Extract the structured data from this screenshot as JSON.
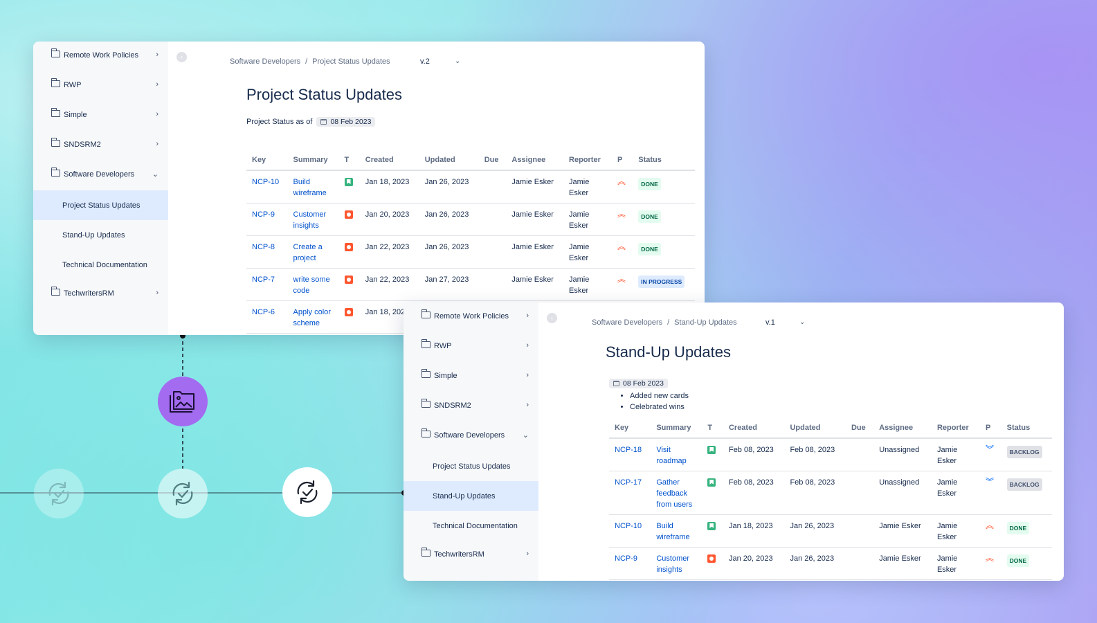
{
  "sidebar": {
    "items": [
      "Remote Work Policies",
      "RWP",
      "Simple",
      "SNDSRM2",
      "Software Developers"
    ],
    "children": [
      "Project Status Updates",
      "Stand-Up Updates",
      "Technical Documentation"
    ],
    "last": "TechwritersRM"
  },
  "window1": {
    "breadcrumb": [
      "Software Developers",
      "Project Status Updates"
    ],
    "version": "v.2",
    "title": "Project Status Updates",
    "status_prefix": "Project Status as of",
    "date": "08 Feb 2023",
    "active_child": "Project Status Updates"
  },
  "window2": {
    "breadcrumb": [
      "Software Developers",
      "Stand-Up Updates"
    ],
    "version": "v.1",
    "title": "Stand-Up Updates",
    "date": "08 Feb 2023",
    "bullets": [
      "Added new cards",
      "Celebrated wins"
    ],
    "active_child": "Stand-Up Updates"
  },
  "table": {
    "headers": [
      "Key",
      "Summary",
      "T",
      "Created",
      "Updated",
      "Due",
      "Assignee",
      "Reporter",
      "P",
      "Status"
    ]
  },
  "rows1": [
    {
      "key": "NCP-10",
      "summary": "Build wireframe",
      "type": "story",
      "created": "Jan 18, 2023",
      "updated": "Jan 26, 2023",
      "due": "",
      "assignee": "Jamie Esker",
      "reporter": "Jamie Esker",
      "priority": "high",
      "status": "DONE"
    },
    {
      "key": "NCP-9",
      "summary": "Customer insights",
      "type": "bug",
      "created": "Jan 20, 2023",
      "updated": "Jan 26, 2023",
      "due": "",
      "assignee": "Jamie Esker",
      "reporter": "Jamie Esker",
      "priority": "high",
      "status": "DONE"
    },
    {
      "key": "NCP-8",
      "summary": "Create a project",
      "type": "bug",
      "created": "Jan 22, 2023",
      "updated": "Jan 26, 2023",
      "due": "",
      "assignee": "Jamie Esker",
      "reporter": "Jamie Esker",
      "priority": "high",
      "status": "DONE"
    },
    {
      "key": "NCP-7",
      "summary": "write some code",
      "type": "bug",
      "created": "Jan 22, 2023",
      "updated": "Jan 27, 2023",
      "due": "",
      "assignee": "Jamie Esker",
      "reporter": "Jamie Esker",
      "priority": "high",
      "status": "IN PROGRESS"
    },
    {
      "key": "NCP-6",
      "summary": "Apply color scheme",
      "type": "bug",
      "created": "Jan 18, 2023",
      "updated": "",
      "due": "",
      "assignee": "",
      "reporter": "",
      "priority": "",
      "status": ""
    }
  ],
  "rows2": [
    {
      "key": "NCP-18",
      "summary": "Visit roadmap",
      "type": "story",
      "created": "Feb 08, 2023",
      "updated": "Feb 08, 2023",
      "due": "",
      "assignee": "Unassigned",
      "reporter": "Jamie Esker",
      "priority": "low",
      "status": "BACKLOG"
    },
    {
      "key": "NCP-17",
      "summary": "Gather feedback from users",
      "type": "story",
      "created": "Feb 08, 2023",
      "updated": "Feb 08, 2023",
      "due": "",
      "assignee": "Unassigned",
      "reporter": "Jamie Esker",
      "priority": "low",
      "status": "BACKLOG"
    },
    {
      "key": "NCP-10",
      "summary": "Build wireframe",
      "type": "story",
      "created": "Jan 18, 2023",
      "updated": "Jan 26, 2023",
      "due": "",
      "assignee": "Jamie Esker",
      "reporter": "Jamie Esker",
      "priority": "high",
      "status": "DONE"
    },
    {
      "key": "NCP-9",
      "summary": "Customer insights",
      "type": "bug",
      "created": "Jan 20, 2023",
      "updated": "Jan 26, 2023",
      "due": "",
      "assignee": "Jamie Esker",
      "reporter": "Jamie Esker",
      "priority": "high",
      "status": "DONE"
    }
  ],
  "colors": {
    "link": "#0052cc",
    "active_bg": "#deebff",
    "accent_purple": "#a36bf0",
    "done_bg": "#e3fcef",
    "done_fg": "#006644"
  },
  "icons": {
    "sync": "sync-check-icon",
    "folder": "folder-icon",
    "media": "folder-image-icon"
  }
}
